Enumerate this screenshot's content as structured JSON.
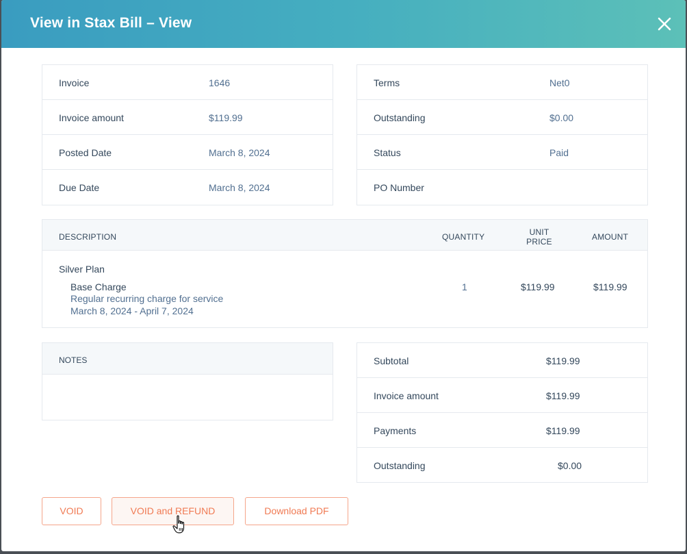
{
  "header": {
    "title": "View in Stax Bill – View"
  },
  "invoice_info": {
    "left": [
      {
        "label": "Invoice",
        "value": "1646"
      },
      {
        "label": "Invoice amount",
        "value": "$119.99"
      },
      {
        "label": "Posted Date",
        "value": "March 8, 2024"
      },
      {
        "label": "Due Date",
        "value": "March 8, 2024"
      }
    ],
    "right": [
      {
        "label": "Terms",
        "value": "Net0"
      },
      {
        "label": "Outstanding",
        "value": "$0.00"
      },
      {
        "label": "Status",
        "value": "Paid"
      },
      {
        "label": "PO Number",
        "value": ""
      }
    ]
  },
  "line_items": {
    "headers": {
      "description": "DESCRIPTION",
      "quantity": "QUANTITY",
      "unit_price_line1": "UNIT",
      "unit_price_line2": "PRICE",
      "amount": "AMOUNT"
    },
    "plan_name": "Silver Plan",
    "charge_name": "Base Charge",
    "charge_description": "Regular recurring charge for service",
    "charge_period": "March 8, 2024 - April 7, 2024",
    "quantity": "1",
    "unit_price": "$119.99",
    "amount": "$119.99"
  },
  "notes": {
    "header": "NOTES",
    "content": ""
  },
  "totals": [
    {
      "label": "Subtotal",
      "value": "$119.99"
    },
    {
      "label": "Invoice amount",
      "value": "$119.99"
    },
    {
      "label": "Payments",
      "value": "$119.99"
    },
    {
      "label": "Outstanding",
      "value": "$0.00"
    }
  ],
  "actions": {
    "void": "VOID",
    "void_refund": "VOID and REFUND",
    "download_pdf": "Download PDF"
  },
  "colors": {
    "header_gradient_start": "#3a9cc0",
    "header_gradient_end": "#5cc0b8",
    "button_accent": "#f07a53",
    "border": "#e5e9ee",
    "table_header_bg": "#f5f8fa"
  }
}
